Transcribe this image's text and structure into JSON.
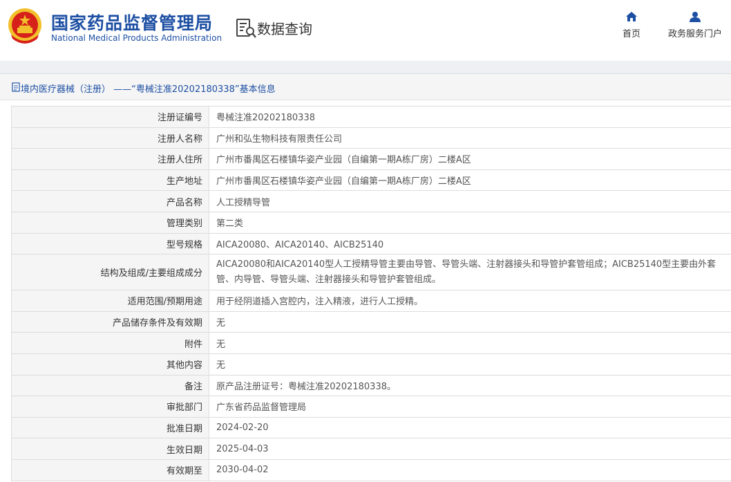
{
  "header": {
    "brand_cn": "国家药品监督管理局",
    "brand_en": "National Medical Products Administration",
    "query_label": "数据查询",
    "nav": [
      {
        "label": "首页",
        "icon": "home-icon"
      },
      {
        "label": "政务服务门户",
        "icon": "user-icon"
      }
    ]
  },
  "panel": {
    "title": "境内医疗器械（注册） ——“粤械注准20202180338”基本信息",
    "rows": [
      {
        "key": "注册证编号",
        "value": "粤械注准20202180338"
      },
      {
        "key": "注册人名称",
        "value": "广州和弘生物科技有限责任公司"
      },
      {
        "key": "注册人住所",
        "value": "广州市番禺区石楼镇华姿产业园（自编第一期A栋厂房）二楼A区"
      },
      {
        "key": "生产地址",
        "value": "广州市番禺区石楼镇华姿产业园（自编第一期A栋厂房）二楼A区"
      },
      {
        "key": "产品名称",
        "value": "人工授精导管"
      },
      {
        "key": "管理类别",
        "value": "第二类"
      },
      {
        "key": "型号规格",
        "value": "AICA20080、AICA20140、AICB25140"
      },
      {
        "key": "结构及组成/主要组成成分",
        "value": "AICA20080和AICA20140型人工授精导管主要由导管、导管头端、注射器接头和导管护套管组成；AICB25140型主要由外套管、内导管、导管头端、注射器接头和导管护套管组成。"
      },
      {
        "key": "适用范围/预期用途",
        "value": "用于经阴道插入宫腔内，注入精液，进行人工授精。"
      },
      {
        "key": "产品储存条件及有效期",
        "value": "无"
      },
      {
        "key": "附件",
        "value": "无"
      },
      {
        "key": "其他内容",
        "value": "无"
      },
      {
        "key": "备注",
        "value": "原产品注册证号：粤械注准20202180338。"
      },
      {
        "key": "审批部门",
        "value": "广东省药品监督管理局"
      },
      {
        "key": "批准日期",
        "value": "2024-02-20"
      },
      {
        "key": "生效日期",
        "value": "2025-04-03"
      },
      {
        "key": "有效期至",
        "value": "2030-04-02"
      }
    ]
  },
  "colors": {
    "brand_blue": "#1d4fa3",
    "emblem_red": "#d6201a",
    "emblem_gold": "#f2c02a"
  }
}
